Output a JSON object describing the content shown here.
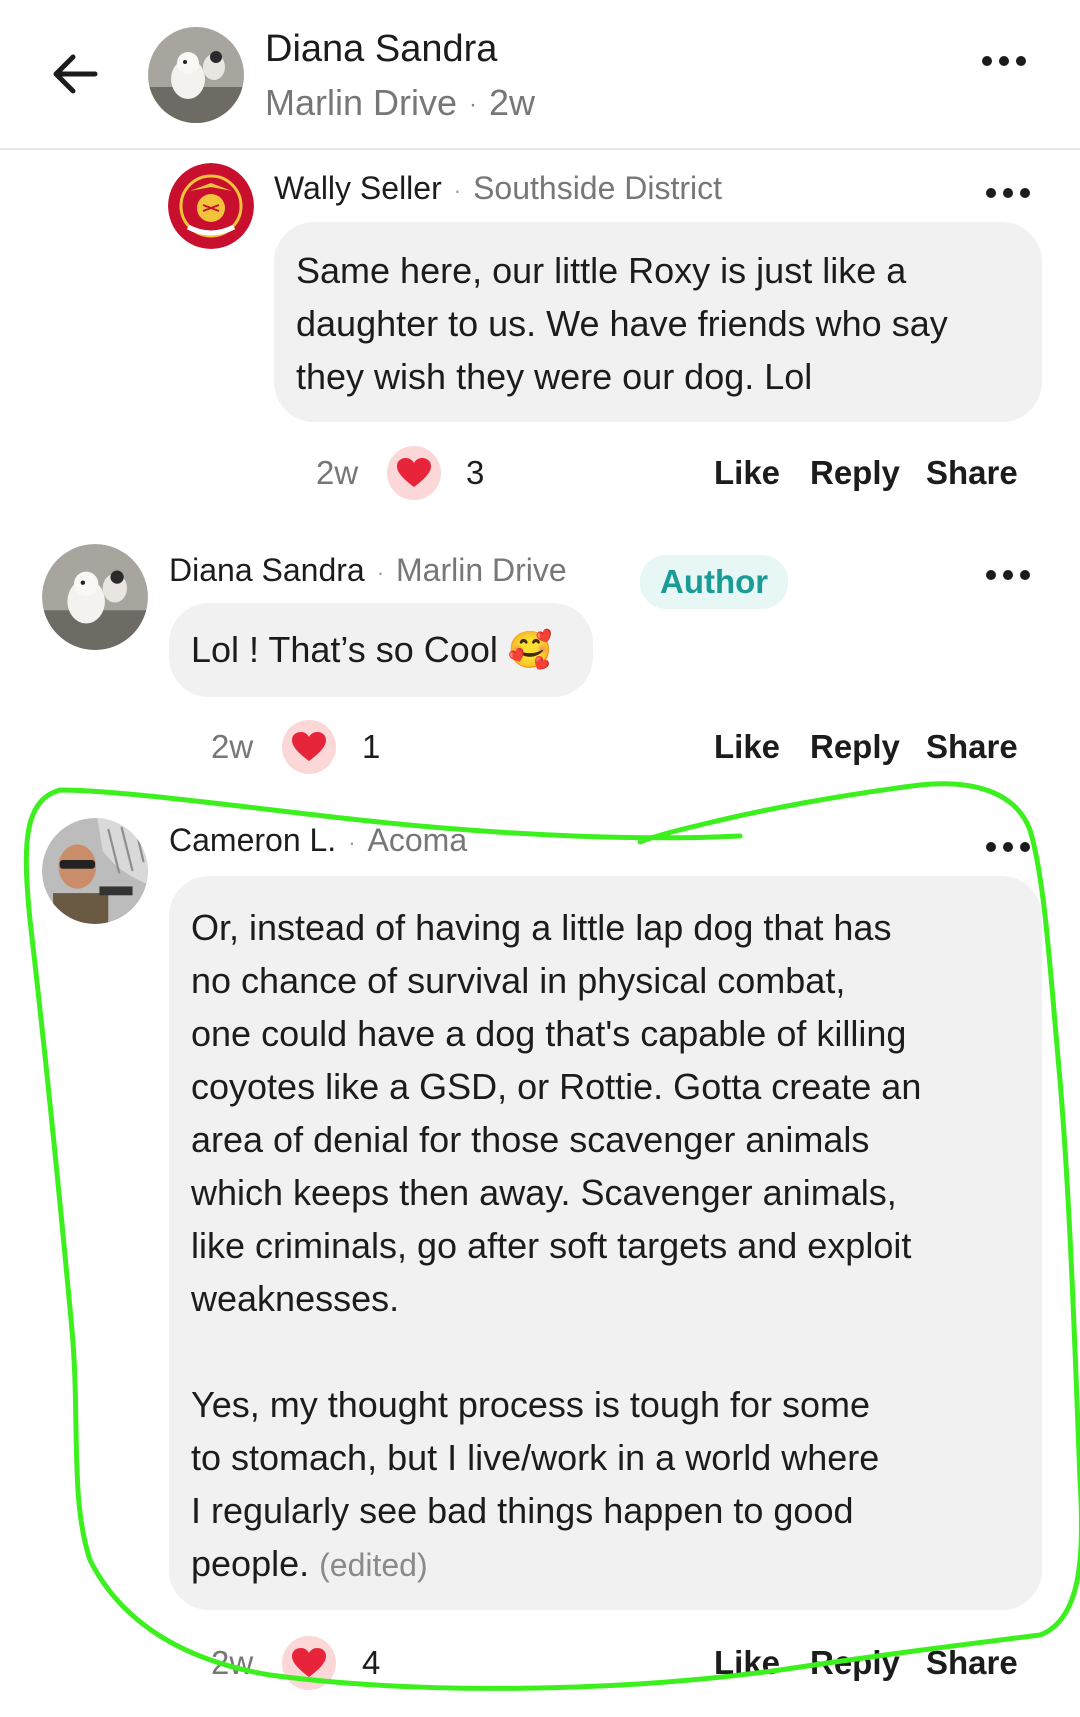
{
  "header": {
    "name": "Diana Sandra",
    "location": "Marlin Drive",
    "time": "2w"
  },
  "comments": [
    {
      "name": "Wally Seller",
      "location": "Southside District",
      "lines": [
        "Same here, our little Roxy is just like a",
        "daughter to us. We have friends who say",
        "they wish they were our dog. Lol"
      ],
      "time": "2w",
      "reactions": "3",
      "like": "Like",
      "reply": "Reply",
      "share": "Share"
    },
    {
      "name": "Diana Sandra",
      "location": "Marlin Drive",
      "badge": "Author",
      "text": "Lol ! That’s so Cool",
      "emoji": "🥰",
      "time": "2w",
      "reactions": "1",
      "like": "Like",
      "reply": "Reply",
      "share": "Share"
    },
    {
      "name": "Cameron L.",
      "location": "Acoma",
      "lines": [
        "Or, instead of having a little lap dog that has",
        "no chance of survival in physical combat,",
        "one could have a dog that's capable of killing",
        "coyotes like a GSD, or Rottie. Gotta create an",
        "area of denial for those scavenger animals",
        "which keeps then away. Scavenger animals,",
        "like criminals, go after soft targets and exploit",
        "weaknesses."
      ],
      "lines2": [
        "Yes, my thought process is tough for some",
        "to stomach, but I live/work in a world where",
        "I regularly see bad things happen to good"
      ],
      "last_line": "people.",
      "edited": "(edited)",
      "time": "2w",
      "reactions": "4",
      "like": "Like",
      "reply": "Reply",
      "share": "Share"
    }
  ],
  "colors": {
    "annotation": "#3cf01e",
    "heart": "#e8243a",
    "author_badge_text": "#1a9b96"
  }
}
